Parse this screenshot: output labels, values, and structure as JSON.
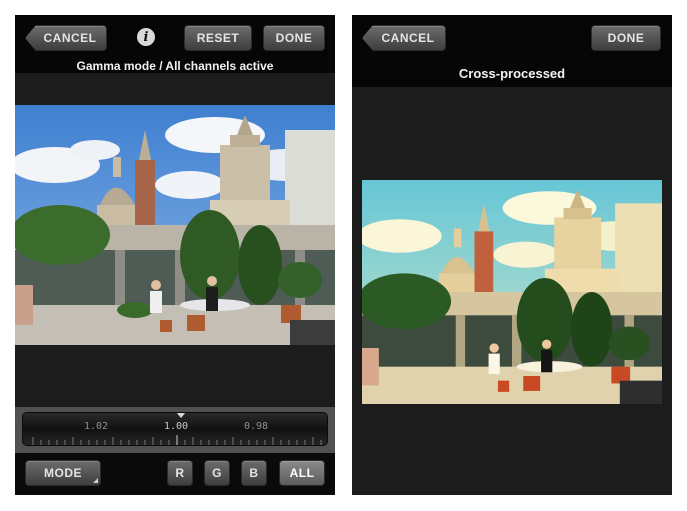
{
  "left_screen": {
    "cancel_label": "CANCEL",
    "info_icon": "info-icon",
    "reset_label": "RESET",
    "done_label": "DONE",
    "mode_title": "Gamma mode / All channels active",
    "slider": {
      "labels": [
        "1.02",
        "1.00",
        "0.98"
      ],
      "current_value": "1.00"
    },
    "bottom": {
      "mode_label": "MODE",
      "channel_r": "R",
      "channel_g": "G",
      "channel_b": "B",
      "channel_all": "ALL",
      "active_channel": "ALL"
    }
  },
  "right_screen": {
    "cancel_label": "CANCEL",
    "done_label": "DONE",
    "mode_title": "Cross-processed"
  },
  "colors": {
    "screen_bg": "#1c1c1c",
    "bar_bg": "#060606",
    "button_text": "#e4e4e4"
  }
}
